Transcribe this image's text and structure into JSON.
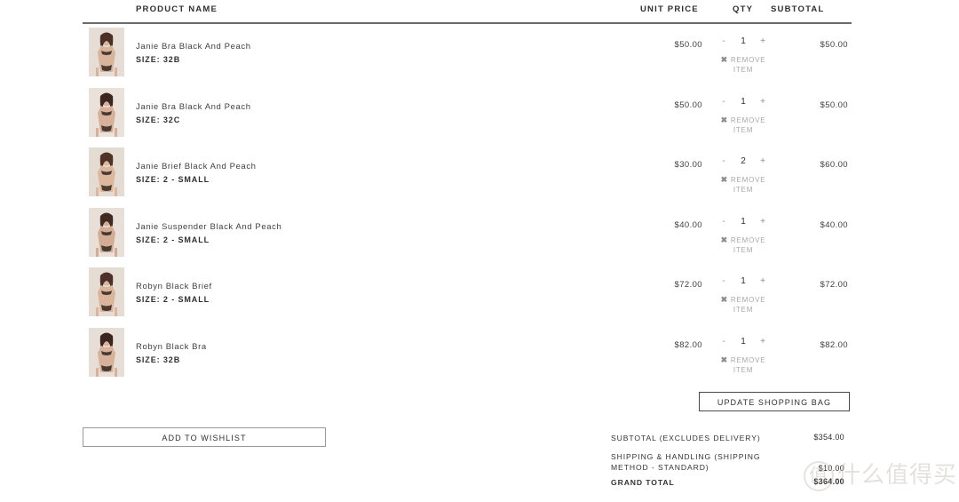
{
  "table": {
    "headers": {
      "product_name": "PRODUCT NAME",
      "unit_price": "UNIT PRICE",
      "qty": "QTY",
      "subtotal": "SUBTOTAL"
    },
    "qty_controls": {
      "decrement": "-",
      "increment": "+",
      "remove_icon": "✖",
      "remove_label_line1": "REMOVE",
      "remove_label_line2": "ITEM"
    },
    "rows": [
      {
        "name": "Janie Bra Black And Peach",
        "size": "SIZE: 32B",
        "unit_price": "$50.00",
        "qty": "1",
        "subtotal": "$50.00",
        "thumb": "product-photo-janie-bra-32b"
      },
      {
        "name": "Janie Bra Black And Peach",
        "size": "SIZE: 32C",
        "unit_price": "$50.00",
        "qty": "1",
        "subtotal": "$50.00",
        "thumb": "product-photo-janie-bra-32c"
      },
      {
        "name": "Janie Brief Black And Peach",
        "size": "SIZE: 2 - SMALL",
        "unit_price": "$30.00",
        "qty": "2",
        "subtotal": "$60.00",
        "thumb": "product-photo-janie-brief"
      },
      {
        "name": "Janie Suspender Black And Peach",
        "size": "SIZE: 2 - SMALL",
        "unit_price": "$40.00",
        "qty": "1",
        "subtotal": "$40.00",
        "thumb": "product-photo-janie-suspender"
      },
      {
        "name": "Robyn Black Brief",
        "size": "SIZE: 2 - SMALL",
        "unit_price": "$72.00",
        "qty": "1",
        "subtotal": "$72.00",
        "thumb": "product-photo-robyn-brief"
      },
      {
        "name": "Robyn Black Bra",
        "size": "SIZE: 32B",
        "unit_price": "$82.00",
        "qty": "1",
        "subtotal": "$82.00",
        "thumb": "product-photo-robyn-bra"
      }
    ]
  },
  "actions": {
    "update_bag": "UPDATE SHOPPING BAG",
    "add_to_wishlist": "ADD TO WISHLIST"
  },
  "totals": {
    "subtotal_label": "SUBTOTAL (EXCLUDES DELIVERY)",
    "subtotal_value": "$354.00",
    "shipping_label": "SHIPPING & HANDLING (SHIPPING METHOD - STANDARD)",
    "shipping_value": "$10.00",
    "grand_total_label": "GRAND TOTAL",
    "grand_total_value": "$364.00"
  },
  "watermark": {
    "mark": "值",
    "text": "什么值得买"
  },
  "colors": {
    "text": "#3a3a3a",
    "muted": "#a8a8a8",
    "rule": "#6b6b6b",
    "background": "#ffffff"
  }
}
